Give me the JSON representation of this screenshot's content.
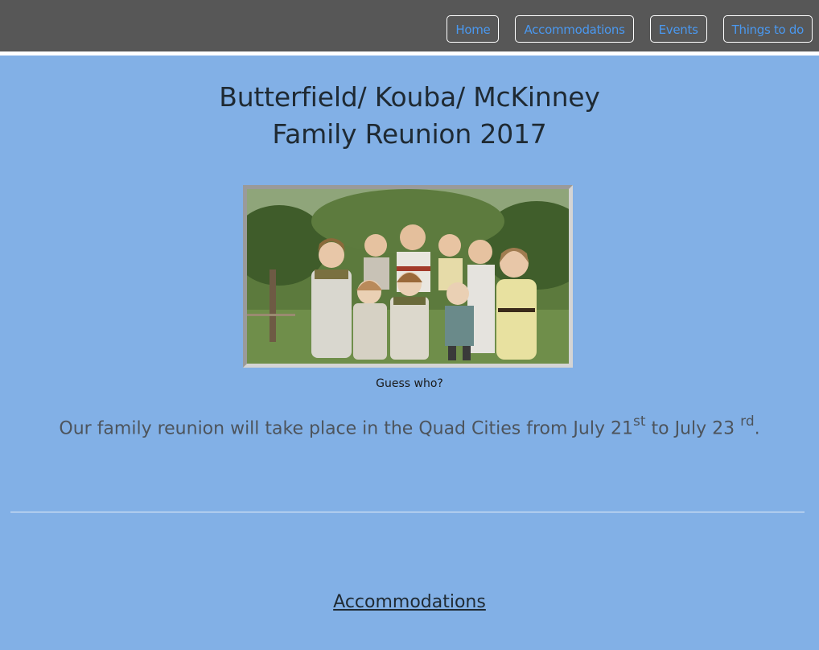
{
  "nav": {
    "items": [
      {
        "label": "Home"
      },
      {
        "label": "Accommodations"
      },
      {
        "label": "Events"
      },
      {
        "label": "Things to do"
      }
    ]
  },
  "header": {
    "title_line1": "Butterfield/ Kouba/ McKinney",
    "title_line2": "Family Reunion 2017"
  },
  "photo": {
    "caption": "Guess who?"
  },
  "intro": {
    "text_before": "Our family reunion will take place in the Quad Cities from July 21",
    "sup1": "st",
    "text_middle": " to July 23 ",
    "sup2": "rd",
    "text_after": "."
  },
  "sections": {
    "accommodations_heading": "Accommodations"
  },
  "colors": {
    "background": "#82b0e6",
    "topbar": "#575757",
    "nav_link": "#4a98ef"
  }
}
